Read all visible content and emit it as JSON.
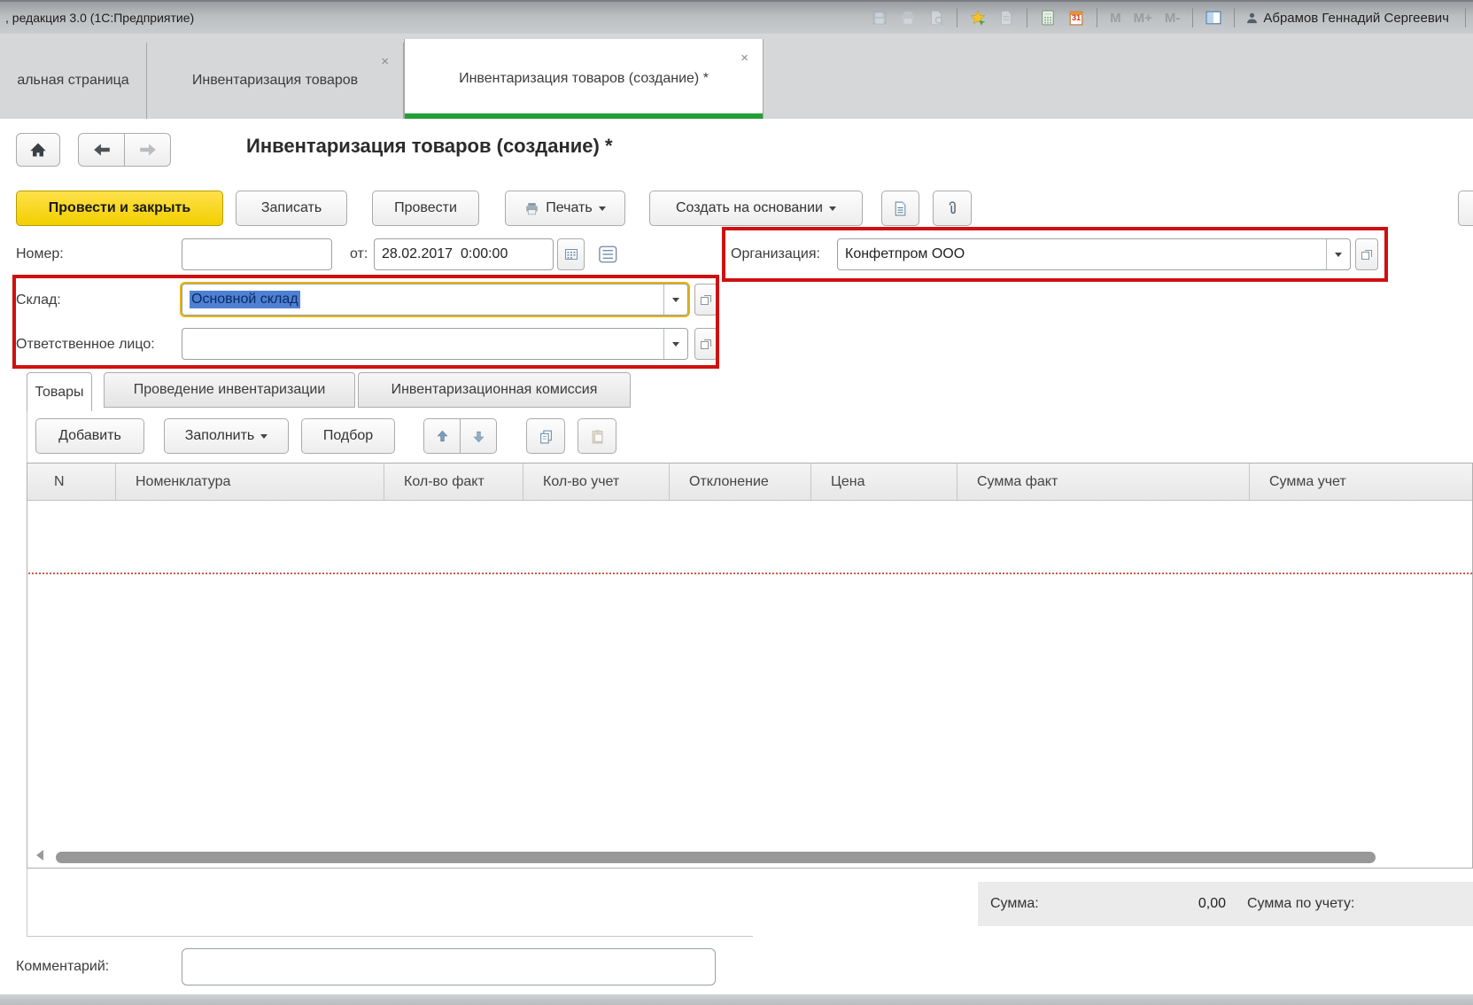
{
  "colors": {
    "accent-green": "#21a038",
    "primary-yellow": "#f2cf00",
    "annotation-red": "#cf1010",
    "selection-blue": "#4f81d2"
  },
  "window": {
    "title": ", редакция 3.0  (1С:Предприятие)",
    "user_name": "Абрамов Геннадий Сергеевич",
    "memory_m": "M",
    "memory_m_plus": "M+",
    "memory_m_minus": "M-"
  },
  "icons": {
    "close": "×",
    "calendar_day": "31"
  },
  "tabs": [
    {
      "label": "альная страница"
    },
    {
      "label": "Инвентаризация товаров"
    },
    {
      "label": "Инвентаризация товаров (создание) *"
    }
  ],
  "page": {
    "title": "Инвентаризация товаров (создание) *"
  },
  "commands": {
    "post_close": "Провести и закрыть",
    "write": "Записать",
    "post": "Провести",
    "print": "Печать",
    "create_based_on": "Создать на основании"
  },
  "form": {
    "number_label": "Номер:",
    "number_value": "",
    "date_label": "от:",
    "date_value": "28.02.2017  0:00:00",
    "org_label": "Организация:",
    "org_value": "Конфетпром ООО",
    "warehouse_label": "Склад:",
    "warehouse_value": "Основной склад",
    "responsible_label": "Ответственное лицо:",
    "responsible_value": "",
    "comment_label": "Комментарий:",
    "comment_value": ""
  },
  "detail_tabs": [
    {
      "label": "Товары"
    },
    {
      "label": "Проведение инвентаризации"
    },
    {
      "label": "Инвентаризационная комиссия"
    }
  ],
  "grid": {
    "toolbar": {
      "add": "Добавить",
      "fill": "Заполнить",
      "pick": "Подбор"
    },
    "columns": [
      "N",
      "Номенклатура",
      "Кол-во факт",
      "Кол-во учет",
      "Отклонение",
      "Цена",
      "Сумма факт",
      "Сумма учет"
    ],
    "rows": []
  },
  "totals": {
    "sum_label": "Сумма:",
    "sum_value": "0,00",
    "sum_account_label": "Сумма по учету:"
  }
}
